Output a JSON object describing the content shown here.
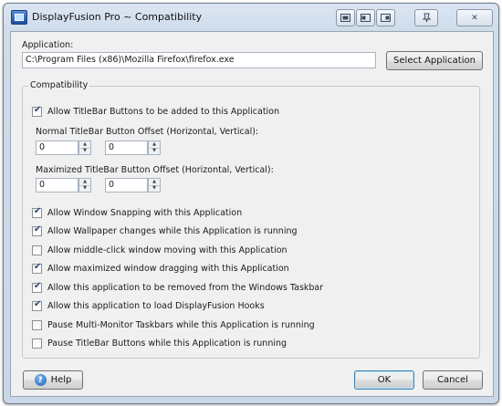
{
  "window": {
    "title": "DisplayFusion Pro ~ Compatibility",
    "titlebar_buttons": {
      "minimize": "─",
      "restore": "❐",
      "close": "✕"
    }
  },
  "application": {
    "label": "Application:",
    "path": "C:\\Program Files (x86)\\Mozilla Firefox\\firefox.exe",
    "select_button": "Select Application"
  },
  "compatibility": {
    "group_label": "Compatibility",
    "allow_titlebar_buttons": {
      "label": "Allow TitleBar Buttons to be added to this Application",
      "checked": true
    },
    "normal_offset": {
      "label": "Normal TitleBar Button Offset (Horizontal, Vertical):",
      "horizontal": "0",
      "vertical": "0"
    },
    "maximized_offset": {
      "label": "Maximized TitleBar Button Offset (Horizontal, Vertical):",
      "horizontal": "0",
      "vertical": "0"
    },
    "options": [
      {
        "label": "Allow Window Snapping with this Application",
        "checked": true
      },
      {
        "label": "Allow Wallpaper changes while this Application is running",
        "checked": true
      },
      {
        "label": "Allow middle-click window moving with this Application",
        "checked": false
      },
      {
        "label": "Allow maximized window dragging with this Application",
        "checked": true
      },
      {
        "label": "Allow this application to be removed from the Windows Taskbar",
        "checked": true
      },
      {
        "label": "Allow this application to load DisplayFusion Hooks",
        "checked": true
      },
      {
        "label": "Pause Multi-Monitor Taskbars while this Application is running",
        "checked": false
      },
      {
        "label": "Pause TitleBar Buttons while this Application is running",
        "checked": false
      }
    ]
  },
  "footer": {
    "help": "Help",
    "ok": "OK",
    "cancel": "Cancel"
  }
}
